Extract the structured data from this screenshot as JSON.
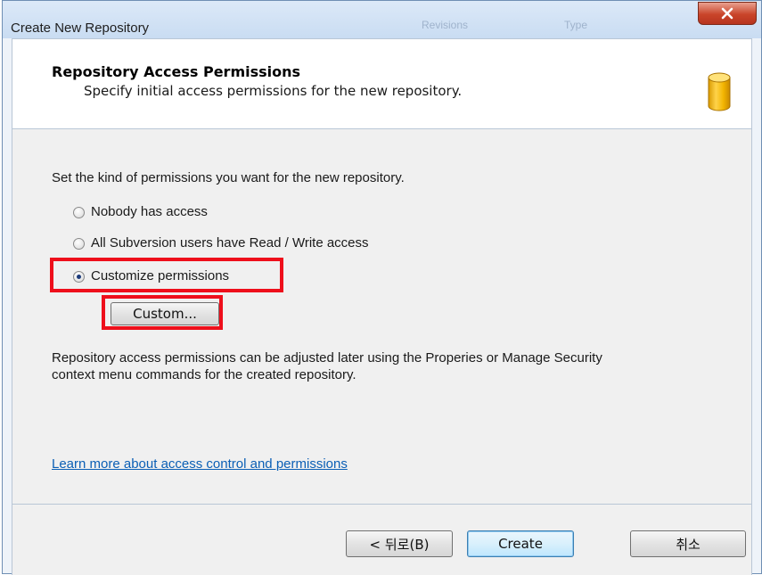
{
  "window": {
    "title": "Create New Repository",
    "background_labels": [
      "Revisions",
      "Type"
    ]
  },
  "header": {
    "title": "Repository Access Permissions",
    "subtitle": "Specify initial access permissions for the new repository.",
    "icon": "database-icon"
  },
  "content": {
    "prompt": "Set the kind of permissions you want for the new repository.",
    "options": [
      {
        "label": "Nobody has access",
        "checked": false
      },
      {
        "label": "All Subversion users have Read / Write access",
        "checked": false
      },
      {
        "label": "Customize permissions",
        "checked": true
      }
    ],
    "custom_button": "Custom...",
    "note_line1": "Repository access permissions can be adjusted later using the Properies or Manage Security",
    "note_line2": "context menu commands for the created repository.",
    "learn_more_link": "Learn more about access control and permissions"
  },
  "footer": {
    "back_button": "< 뒤로(B)",
    "create_button": "Create",
    "cancel_button": "취소"
  },
  "colors": {
    "highlight": "#ee0f1b",
    "link": "#0b5fb5",
    "close_button": "#c9452a"
  }
}
